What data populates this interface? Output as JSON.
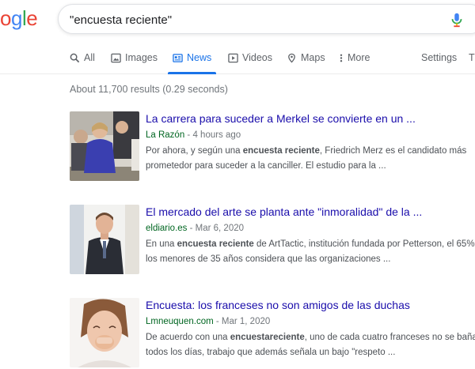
{
  "logo": {
    "letters": [
      "o",
      "g",
      "l",
      "e"
    ],
    "colors": [
      "#ea4335",
      "#4285f4",
      "#34a853",
      "#ea4335"
    ]
  },
  "search": {
    "query": "\"encuesta reciente\""
  },
  "tabs": [
    {
      "label": "All",
      "icon": "search-icon"
    },
    {
      "label": "Images",
      "icon": "image-icon"
    },
    {
      "label": "News",
      "icon": "news-icon"
    },
    {
      "label": "Videos",
      "icon": "play-icon"
    },
    {
      "label": "Maps",
      "icon": "location-icon"
    },
    {
      "label": "More",
      "icon": "vertical-dots-icon"
    },
    {
      "label": "Settings"
    },
    {
      "label": "T"
    }
  ],
  "stats": "About 11,700 results (0.29 seconds)",
  "results": [
    {
      "title": "La carrera para suceder a Merkel se convierte en un ...",
      "source": "La Razón",
      "date": " - 4 hours ago",
      "line1_a": "Por ahora, y según una ",
      "line1_b": "encuesta reciente",
      "line1_c": ", Friedrich Merz es el candidato más",
      "line2": "prometedor para suceder a la canciller. El estudio para la ..."
    },
    {
      "title": "El mercado del arte se planta ante \"inmoralidad\" de la ...",
      "source": "eldiario.es",
      "date": " - Mar 6, 2020",
      "line1_a": "En una ",
      "line1_b": "encuesta reciente",
      "line1_c": " de ArtTactic, institución fundada por Petterson, el 65%",
      "line2": "los menores de 35 años considera que las organizaciones ..."
    },
    {
      "title": "Encuesta: los franceses no son amigos de las duchas",
      "source": "Lmneuquen.com",
      "date": " - Mar 1, 2020",
      "line1_a": "De acuerdo con una ",
      "line1_b": "encuestareciente",
      "line1_c": ", uno de cada cuatro franceses no se baña",
      "line2": "todos los días, trabajo que además señala un bajo \"respeto ..."
    }
  ],
  "colors": {
    "link": "#1a0dab",
    "source": "#006621",
    "accent": "#1a73e8"
  }
}
